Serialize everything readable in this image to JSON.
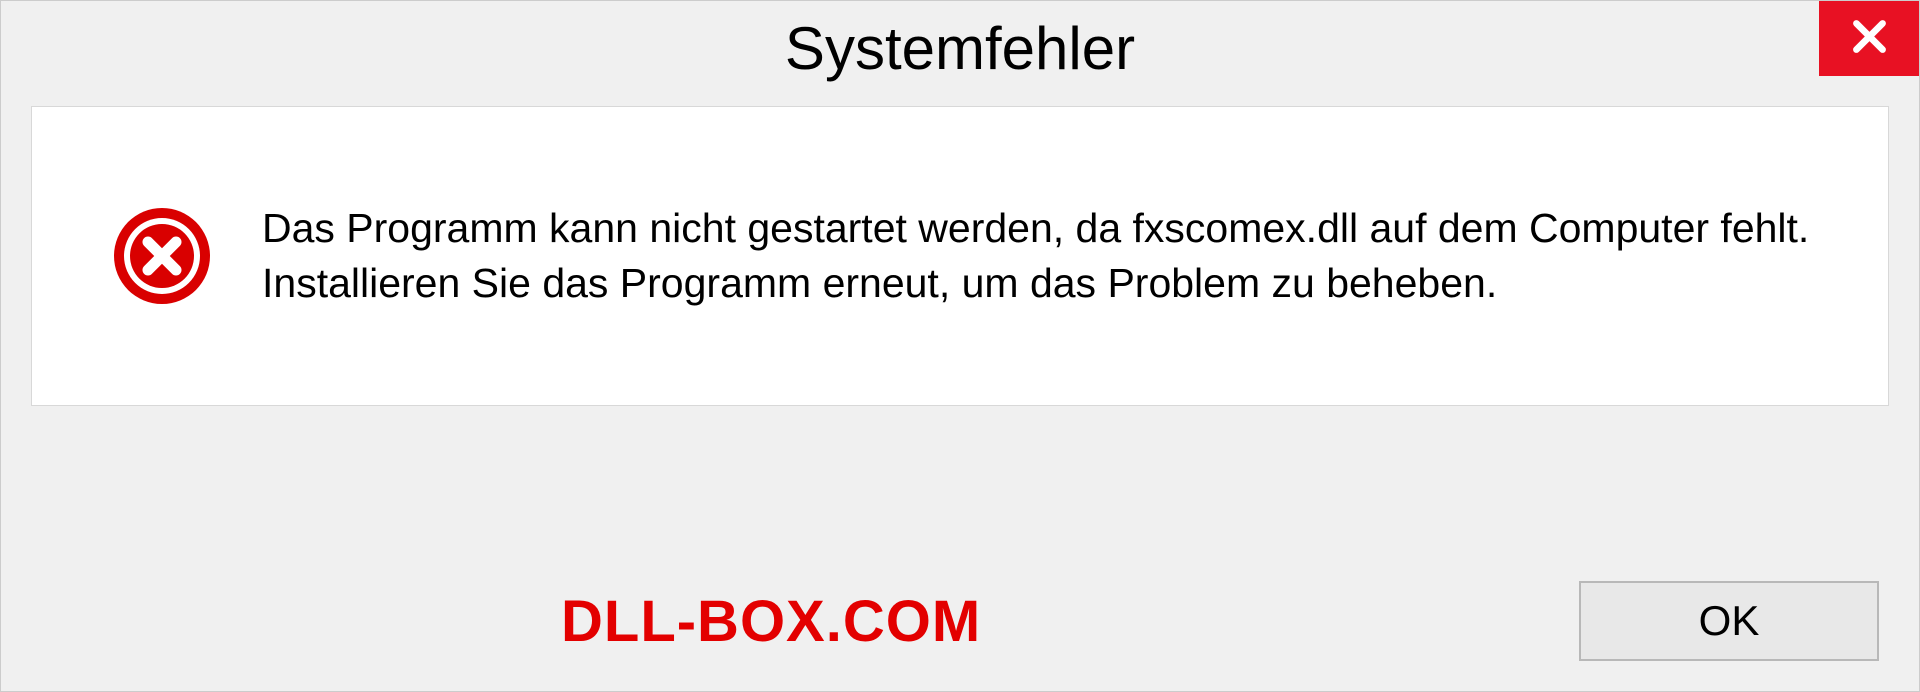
{
  "dialog": {
    "title": "Systemfehler",
    "message": "Das Programm kann nicht gestartet werden, da fxscomex.dll auf dem Computer fehlt. Installieren Sie das Programm erneut, um das Problem zu beheben.",
    "ok_label": "OK"
  },
  "watermark": "DLL-BOX.COM"
}
